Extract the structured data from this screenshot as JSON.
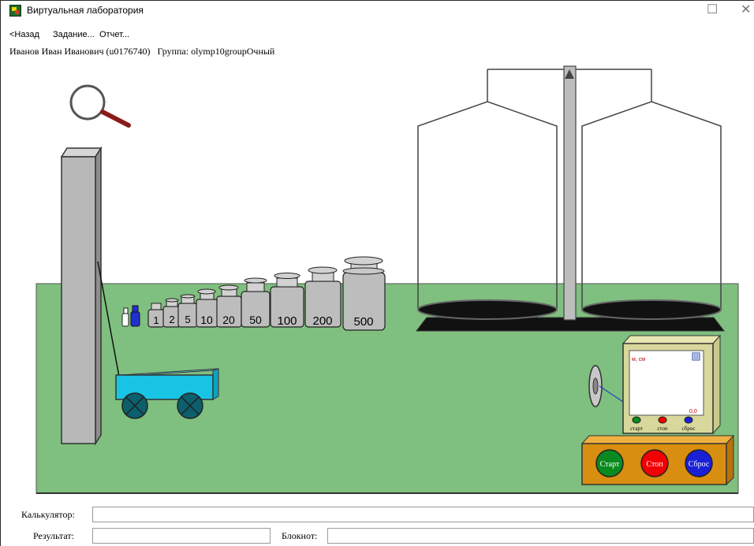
{
  "window": {
    "title": "Виртуальная лаборатория"
  },
  "menu": {
    "back": "<Назад",
    "task": "Задание...",
    "report": "Отчет..."
  },
  "user": {
    "name": "Иванов Иван Иванович (u0176740)",
    "group": "Группа: olymp10groupОчный"
  },
  "weights": [
    "1",
    "2",
    "5",
    "10",
    "20",
    "50",
    "100",
    "200",
    "500"
  ],
  "timer": {
    "scale_label": "м, см",
    "value_label": "0,0",
    "indicators": [
      "старт",
      "стоп",
      "сброс"
    ]
  },
  "controls": {
    "start": "Старт",
    "stop": "Стоп",
    "reset": "Сброс"
  },
  "bottom": {
    "calculator_label": "Калькулятор:",
    "calculator_value": "",
    "result_label": "Результат:",
    "result_value": "",
    "notebook_label": "Блокнот:",
    "notebook_value": ""
  },
  "colors": {
    "floor": "#7fbf7f",
    "cart": "#18c4e4",
    "start": "#0a8a1e",
    "stop": "#f00000",
    "reset": "#1a20d8",
    "panel": "#d88e10"
  }
}
